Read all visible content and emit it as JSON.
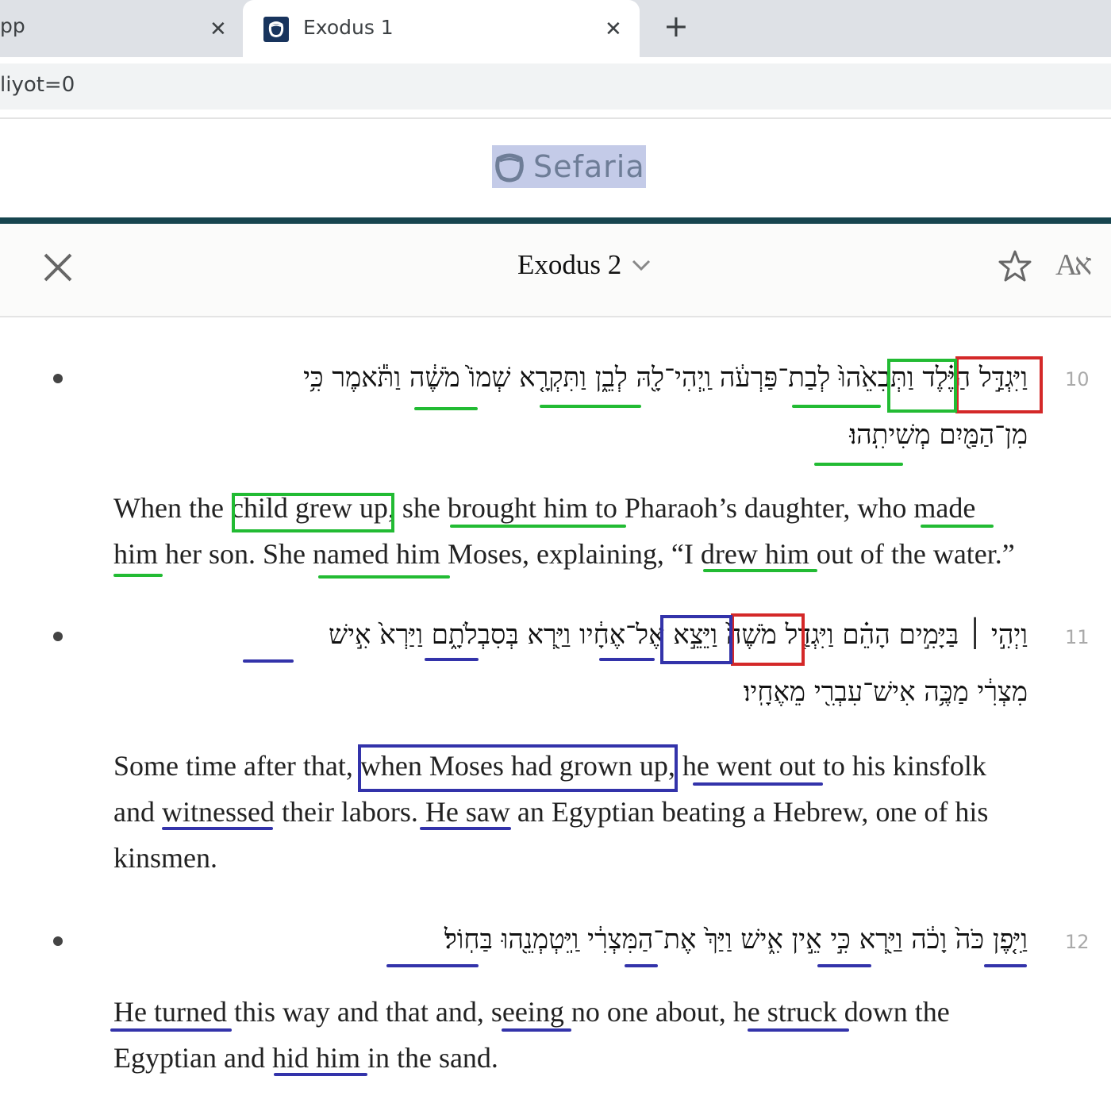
{
  "browser": {
    "prev_tab_label": "pp",
    "active_tab_title": "Exodus 1",
    "new_tab_symbol": "+",
    "close_symbol": "✕",
    "url_fragment": "liyot=0"
  },
  "site": {
    "logo_text": "Sefaria"
  },
  "reader": {
    "title": "Exodus 2",
    "close_symbol": "✕",
    "font_icon_text": "Aא"
  },
  "verses": [
    {
      "number": "10",
      "hebrew_line1": "וַיִּגְדַּ֣ל הַיֶּ֗לֶד וַתְּבִאֵ֙הוּ֙ לְבַת־פַּרְעֹ֔ה וַֽיְהִי־לָ֖הּ לְבֵ֑ן וַתִּקְרָ֤א שְׁמוֹ֙ מֹשֶׁ֔ה וַתֹּ֕אמֶר כִּ֥י",
      "hebrew_line2": "מִן־הַמַּ֖יִם מְשִׁיתִֽהוּ׃",
      "english_line1": "When the child grew up, she brought him to Pharaoh’s daughter, who made",
      "english_line2": "him her son. She named him Moses, explaining, “I drew him out of the water.”"
    },
    {
      "number": "11",
      "hebrew_line1": "וַיְהִ֣י ׀ בַּיָּמִ֣ים הָהֵ֗ם וַיִּגְדַּ֤ל מֹשֶׁה֙ וַיֵּצֵ֣א אֶל־אֶחָ֔יו וַיַּ֖רְא בְּסִבְלֹתָ֑ם וַיַּרְא֙ אִ֣ישׁ",
      "hebrew_line2": "מִצְרִ֔י מַכֶּ֥ה אִישׁ־עִבְרִ֖י מֵאֶחָֽיו׃",
      "english_line1": "Some time after that, when Moses had grown up, he went out to his kinsfolk",
      "english_line2": "and witnessed their labors. He saw an Egyptian beating a Hebrew, one of his",
      "english_line3": "kinsmen."
    },
    {
      "number": "12",
      "hebrew_line1": "וַיִּ֤פֶן כֹּה֙ וָכֹ֔ה וַיַּ֖רְא כִּ֣י אֵ֣ין אִ֑ישׁ וַיַּךְ֙ אֶת־הַמִּצְרִ֔י וַֽיִּטְמְנֵ֖הוּ בַּחֽוֹל׃",
      "english_line1": "He turned this way and that and, seeing no one about, he struck down the",
      "english_line2": "Egyptian and hid him in the sand."
    }
  ],
  "colors": {
    "highlight_green": "#22bb33",
    "highlight_red": "#d42828",
    "highlight_blue": "#3333aa",
    "header_rule": "#17454f"
  }
}
